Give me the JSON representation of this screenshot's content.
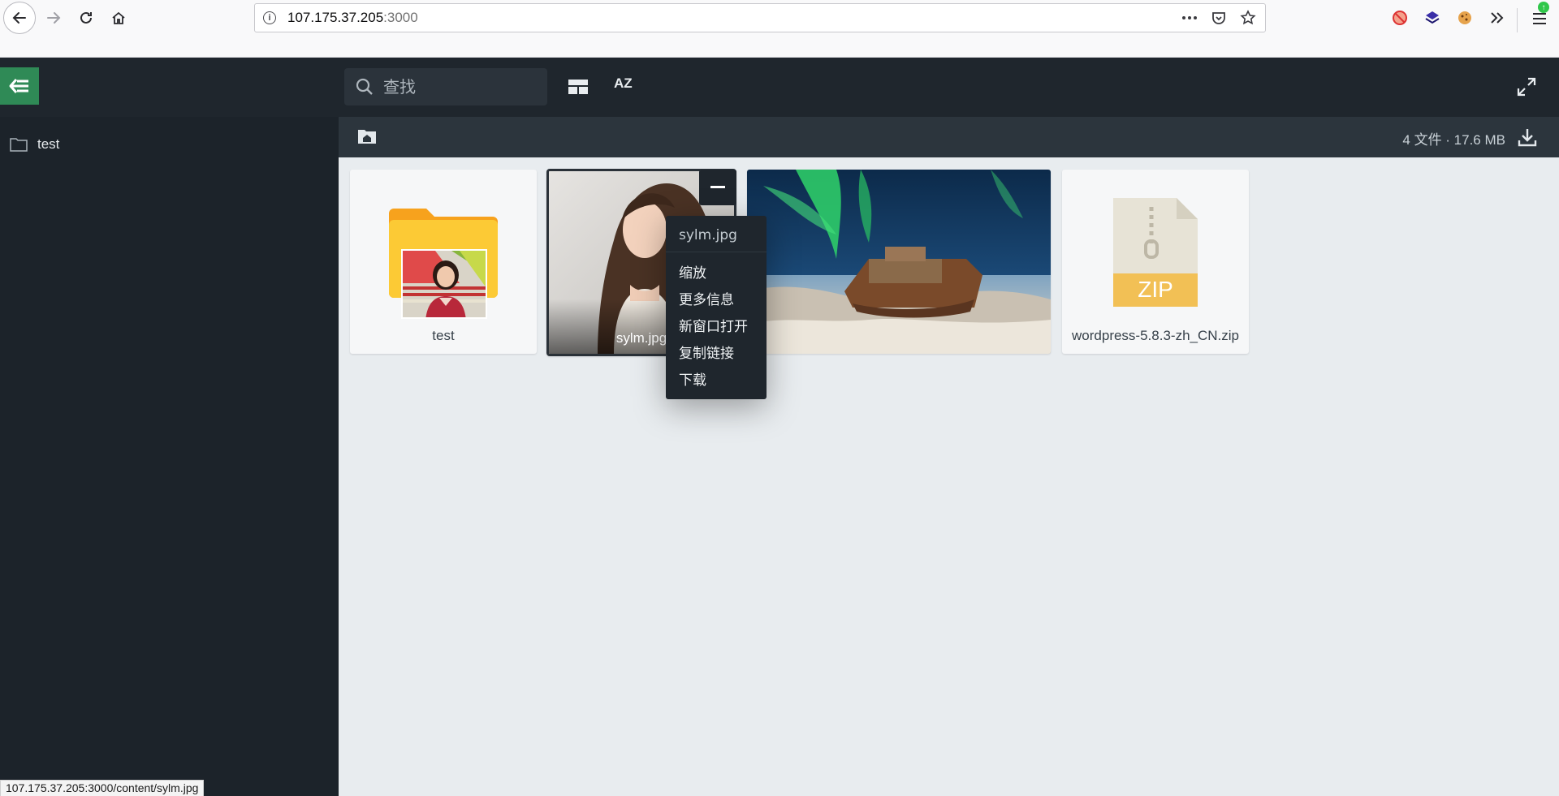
{
  "browser": {
    "url_host": "107.175.37.205",
    "url_port": ":3000",
    "status_url": "107.175.37.205:3000/content/sylm.jpg"
  },
  "header": {
    "search_placeholder": "查找",
    "sort_label": "AZ"
  },
  "sidebar": {
    "items": [
      {
        "label": "test",
        "icon": "folder-outline-icon"
      }
    ]
  },
  "toolbar": {
    "summary": "4 文件 · 17.6 MB"
  },
  "files": [
    {
      "name": "test",
      "type": "folder"
    },
    {
      "name": "sylm.jpg",
      "type": "image"
    },
    {
      "name": "",
      "type": "image"
    },
    {
      "name": "wordpress-5.8.3-zh_CN.zip",
      "type": "zip",
      "badge": "ZIP"
    }
  ],
  "context_menu": {
    "title": "sylm.jpg",
    "items": [
      "缩放",
      "更多信息",
      "新窗口打开",
      "复制链接",
      "下载"
    ]
  },
  "colors": {
    "accent": "#2f8a56",
    "header_bg": "#1f262d",
    "sidebar_bg": "#1c232a",
    "content_bg": "#e8ecef",
    "zip_badge": "#f2c055"
  }
}
